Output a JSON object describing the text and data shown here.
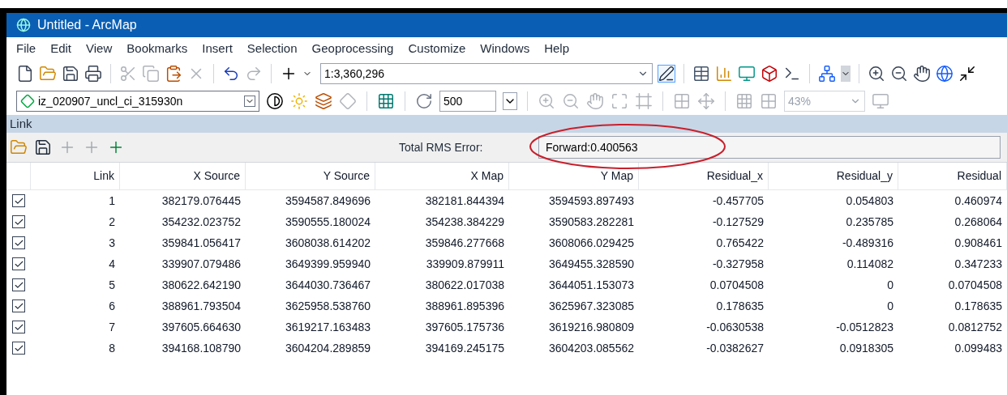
{
  "window": {
    "title": "Untitled - ArcMap"
  },
  "menu": [
    "File",
    "Edit",
    "View",
    "Bookmarks",
    "Insert",
    "Selection",
    "Geoprocessing",
    "Customize",
    "Windows",
    "Help"
  ],
  "standard_toolbar": {
    "scale": "1:3,360,296"
  },
  "georef_toolbar": {
    "layer": "iz_020907_uncl_ci_315930n",
    "value": "500",
    "zoom": "43%"
  },
  "link_window": {
    "title": "Link",
    "rms_label": "Total RMS Error:",
    "rms_value": "Forward:0.400563",
    "columns": [
      "Link",
      "X Source",
      "Y Source",
      "X Map",
      "Y Map",
      "Residual_x",
      "Residual_y",
      "Residual"
    ],
    "rows": [
      {
        "checked": true,
        "cells": [
          "1",
          "382179.076445",
          "3594587.849696",
          "382181.844394",
          "3594593.897493",
          "-0.457705",
          "0.054803",
          "0.460974"
        ]
      },
      {
        "checked": true,
        "cells": [
          "2",
          "354232.023752",
          "3590555.180024",
          "354238.384229",
          "3590583.282281",
          "-0.127529",
          "0.235785",
          "0.268064"
        ]
      },
      {
        "checked": true,
        "cells": [
          "3",
          "359841.056417",
          "3608038.614202",
          "359846.277668",
          "3608066.029425",
          "0.765422",
          "-0.489316",
          "0.908461"
        ]
      },
      {
        "checked": true,
        "cells": [
          "4",
          "339907.079486",
          "3649399.959940",
          "339909.879911",
          "3649455.328590",
          "-0.327958",
          "0.114082",
          "0.347233"
        ]
      },
      {
        "checked": true,
        "cells": [
          "5",
          "380622.642190",
          "3644030.736467",
          "380622.017038",
          "3644051.153073",
          "0.0704508",
          "0",
          "0.0704508"
        ]
      },
      {
        "checked": true,
        "cells": [
          "6",
          "388961.793504",
          "3625958.538760",
          "388961.895396",
          "3625967.323085",
          "0.178635",
          "0",
          "0.178635"
        ]
      },
      {
        "checked": true,
        "cells": [
          "7",
          "397605.664630",
          "3619217.163483",
          "397605.175736",
          "3619216.980809",
          "-0.0630538",
          "-0.0512823",
          "0.0812752"
        ]
      },
      {
        "checked": true,
        "cells": [
          "8",
          "394168.108790",
          "3604204.289859",
          "394169.245175",
          "3604203.085562",
          "-0.0382627",
          "0.0918305",
          "0.099483"
        ]
      }
    ]
  }
}
